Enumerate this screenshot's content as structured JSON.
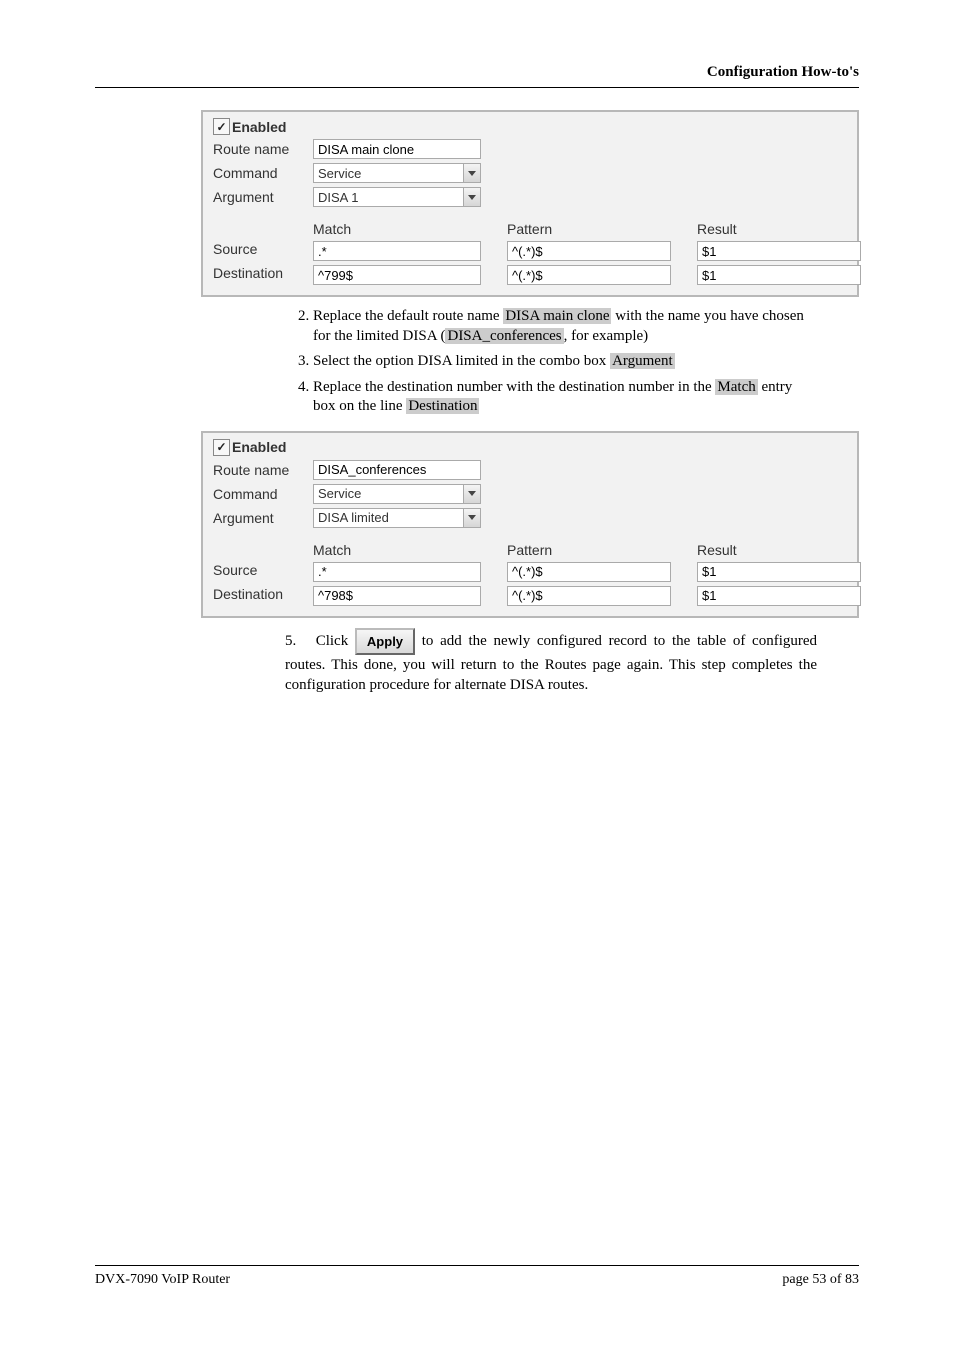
{
  "header": {
    "title": "Configuration How-to's"
  },
  "panel1": {
    "enabled_label": "Enabled",
    "checked": true,
    "route_name_label": "Route name",
    "route_name_value": "DISA main clone",
    "command_label": "Command",
    "command_value": "Service",
    "argument_label": "Argument",
    "argument_value": "DISA 1",
    "cols": {
      "match": "Match",
      "pattern": "Pattern",
      "result": "Result"
    },
    "source": {
      "label": "Source",
      "match": ".*",
      "pattern": "^(.*)$",
      "result": "$1"
    },
    "destination": {
      "label": "Destination",
      "match": "^799$",
      "pattern": "^(.*)$",
      "result": "$1"
    }
  },
  "steps_a": {
    "s2_a": "Replace the default route name ",
    "s2_hl1": "DISA main clone",
    "s2_b": " with the name you have chosen for the limited DISA (",
    "s2_hl2": "DISA_conferences",
    "s2_c": ", for example)",
    "s3_a": "Select the option DISA limited in the combo box ",
    "s3_hl": "Argument",
    "s4_a": "Replace the destination number       with the destination number       in the ",
    "s4_hl1": "Match",
    "s4_b": " entry box on the line ",
    "s4_hl2": "Destination"
  },
  "panel2": {
    "enabled_label": "Enabled",
    "checked": true,
    "route_name_label": "Route name",
    "route_name_value": "DISA_conferences",
    "command_label": "Command",
    "command_value": "Service",
    "argument_label": "Argument",
    "argument_value": "DISA limited",
    "cols": {
      "match": "Match",
      "pattern": "Pattern",
      "result": "Result"
    },
    "source": {
      "label": "Source",
      "match": ".*",
      "pattern": "^(.*)$",
      "result": "$1"
    },
    "destination": {
      "label": "Destination",
      "match": "^798$",
      "pattern": "^(.*)$",
      "result": "$1"
    }
  },
  "step5": {
    "num": "5.",
    "a": "Click ",
    "btn": "Apply",
    "b": " to add the newly configured record to the table of configured routes. This done, you will return to the Routes page again. This step completes the configuration procedure for alternate DISA routes."
  },
  "footer": {
    "left": "DVX-7090 VoIP Router",
    "right": "page 53 of 83"
  }
}
